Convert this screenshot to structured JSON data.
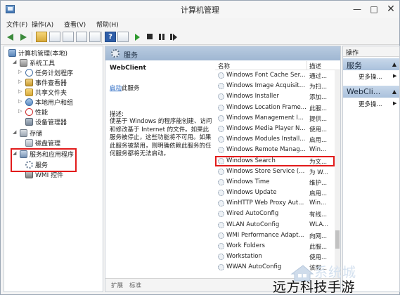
{
  "window": {
    "title": "计算机管理",
    "controls": {
      "minimize": "—",
      "maximize": "□",
      "close": "✕"
    }
  },
  "menubar": {
    "items": [
      "文件(F)",
      "操作(A)",
      "查看(V)",
      "帮助(H)"
    ]
  },
  "toolbar": {
    "icons": [
      "back-arrow-icon",
      "forward-arrow-icon",
      "up-folder-icon",
      "console-tree-icon",
      "properties-icon",
      "refresh-icon",
      "export-icon",
      "help-icon",
      "pane-icon",
      "start-icon",
      "stop-icon",
      "pause-icon",
      "restart-icon"
    ]
  },
  "tree": {
    "items": [
      {
        "label": "计算机管理(本地)",
        "icon": "computer-icon"
      },
      {
        "label": "系统工具",
        "icon": "tools-icon"
      },
      {
        "label": "任务计划程序",
        "icon": "clock-icon"
      },
      {
        "label": "事件查看器",
        "icon": "event-viewer-icon"
      },
      {
        "label": "共享文件夹",
        "icon": "shared-folder-icon"
      },
      {
        "label": "本地用户和组",
        "icon": "users-icon"
      },
      {
        "label": "性能",
        "icon": "performance-icon"
      },
      {
        "label": "设备管理器",
        "icon": "device-manager-icon"
      },
      {
        "label": "存储",
        "icon": "storage-icon"
      },
      {
        "label": "磁盘管理",
        "icon": "disk-icon"
      },
      {
        "label": "服务和应用程序",
        "icon": "services-apps-icon"
      },
      {
        "label": "服务",
        "icon": "gear-icon"
      },
      {
        "label": "WMI 控件",
        "icon": "wmi-icon"
      }
    ]
  },
  "center": {
    "header": "服务",
    "selected_service": "WebClient",
    "link_text": "启动",
    "link_suffix": "此服务",
    "description_label": "描述:",
    "description": "使基于 Windows 的程序能创建、访问和修改基于 Internet 的文件。如果此服务被停止，这些功能将不可用。如果此服务被禁用，则明确依赖此服务的任何服务都将无法启动。",
    "columns": {
      "name": "名称",
      "description": "描述"
    },
    "services": [
      {
        "name": "Windows Font Cache Ser...",
        "desc": "通过..."
      },
      {
        "name": "Windows Image Acquisiti...",
        "desc": "为扫..."
      },
      {
        "name": "Windows Installer",
        "desc": "添加..."
      },
      {
        "name": "Windows Location Frame...",
        "desc": "此服..."
      },
      {
        "name": "Windows Management I...",
        "desc": "提供..."
      },
      {
        "name": "Windows Media Player N...",
        "desc": "使用..."
      },
      {
        "name": "Windows Modules Install...",
        "desc": "启用..."
      },
      {
        "name": "Windows Remote Manag...",
        "desc": "Win..."
      },
      {
        "name": "Windows Search",
        "desc": "为文..."
      },
      {
        "name": "Windows Store Service (...",
        "desc": "为 W..."
      },
      {
        "name": "Windows Time",
        "desc": "维护..."
      },
      {
        "name": "Windows Update",
        "desc": "启用..."
      },
      {
        "name": "WinHTTP Web Proxy Aut...",
        "desc": "Win..."
      },
      {
        "name": "Wired AutoConfig",
        "desc": "有线..."
      },
      {
        "name": "WLAN AutoConfig",
        "desc": "WLA..."
      },
      {
        "name": "WMI Performance Adapt...",
        "desc": "向网..."
      },
      {
        "name": "Work Folders",
        "desc": "此服..."
      },
      {
        "name": "Workstation",
        "desc": "使用..."
      },
      {
        "name": "WWAN AutoConfig",
        "desc": "该服..."
      }
    ],
    "tabs": [
      "扩展",
      "标准"
    ]
  },
  "actions": {
    "title": "操作",
    "groups": [
      {
        "header": "服务",
        "more": "更多操..."
      },
      {
        "header": "WebCli...",
        "more": "更多操..."
      }
    ]
  },
  "watermark": {
    "text": "系统城",
    "caption": "远方科技手游"
  },
  "colors": {
    "highlight_box": "#e21b1b",
    "header_blue": "#9fb7d2",
    "link": "#1b5fbf"
  }
}
